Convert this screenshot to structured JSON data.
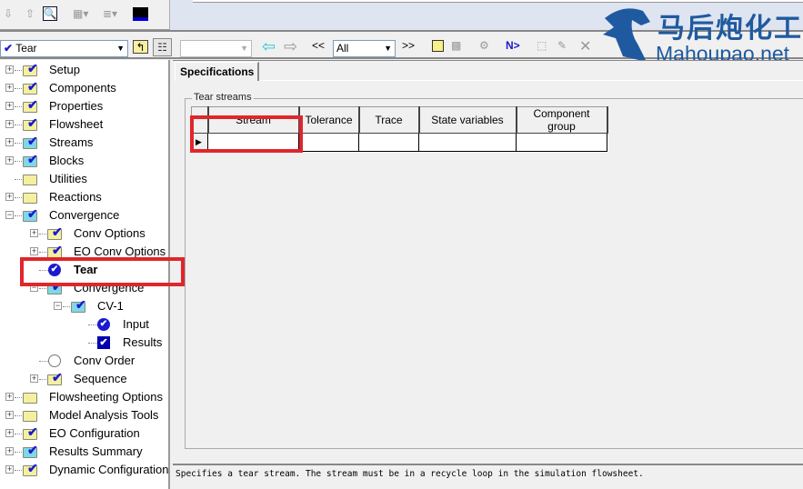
{
  "toolbar": {
    "nav_combo": "Tear",
    "all_combo": "All",
    "prev_label": "<<",
    "next_label": ">>",
    "next_input_label": "N>"
  },
  "watermark": {
    "cn": "马后炮化工",
    "en": "Mahoupao.net"
  },
  "tree": [
    {
      "label": "Setup",
      "level": 0,
      "icon": "folder-check",
      "expand": "+"
    },
    {
      "label": "Components",
      "level": 0,
      "icon": "folder-check",
      "expand": "+"
    },
    {
      "label": "Properties",
      "level": 0,
      "icon": "folder-check",
      "expand": "+"
    },
    {
      "label": "Flowsheet",
      "level": 0,
      "icon": "folder-check",
      "expand": "+"
    },
    {
      "label": "Streams",
      "level": 0,
      "icon": "folder-check-blue",
      "expand": "+"
    },
    {
      "label": "Blocks",
      "level": 0,
      "icon": "folder-check-blue",
      "expand": "+"
    },
    {
      "label": "Utilities",
      "level": 0,
      "icon": "folder",
      "expand": ""
    },
    {
      "label": "Reactions",
      "level": 0,
      "icon": "folder",
      "expand": "+"
    },
    {
      "label": "Convergence",
      "level": 0,
      "icon": "folder-check-blue",
      "expand": "-"
    },
    {
      "label": "Conv Options",
      "level": 1,
      "icon": "folder-check",
      "expand": "+"
    },
    {
      "label": "EO Conv Options",
      "level": 1,
      "icon": "folder-check",
      "expand": "+"
    },
    {
      "label": "Tear",
      "level": 1,
      "icon": "circle-check",
      "expand": "",
      "selected": true
    },
    {
      "label": "Convergence",
      "level": 1,
      "icon": "folder-check-blue",
      "expand": "-"
    },
    {
      "label": "CV-1",
      "level": 2,
      "icon": "folder-check-blue",
      "expand": "-"
    },
    {
      "label": "Input",
      "level": 3,
      "icon": "circle-check",
      "expand": ""
    },
    {
      "label": "Results",
      "level": 3,
      "icon": "square-check",
      "expand": ""
    },
    {
      "label": "Conv Order",
      "level": 1,
      "icon": "circle-empty",
      "expand": ""
    },
    {
      "label": "Sequence",
      "level": 1,
      "icon": "folder-check",
      "expand": "+"
    },
    {
      "label": "Flowsheeting Options",
      "level": 0,
      "icon": "folder",
      "expand": "+"
    },
    {
      "label": "Model Analysis Tools",
      "level": 0,
      "icon": "folder",
      "expand": "+"
    },
    {
      "label": "EO Configuration",
      "level": 0,
      "icon": "folder-check",
      "expand": "+"
    },
    {
      "label": "Results Summary",
      "level": 0,
      "icon": "folder-check-blue",
      "expand": "+"
    },
    {
      "label": "Dynamic Configuration",
      "level": 0,
      "icon": "folder-check",
      "expand": "+"
    }
  ],
  "main": {
    "tab": "Specifications",
    "group_label": "Tear streams",
    "columns": [
      "Stream",
      "Tolerance",
      "Trace",
      "State variables",
      "Component group"
    ],
    "row": [
      "",
      "",
      "",
      "",
      ""
    ]
  },
  "status": "Specifies a tear stream. The stream must be in a recycle loop in the simulation flowsheet.",
  "colors": {
    "highlight": "#e0262b",
    "check": "#1a1ad0",
    "folder": "#f5f0a0",
    "folder_done": "#7fd8e8"
  }
}
